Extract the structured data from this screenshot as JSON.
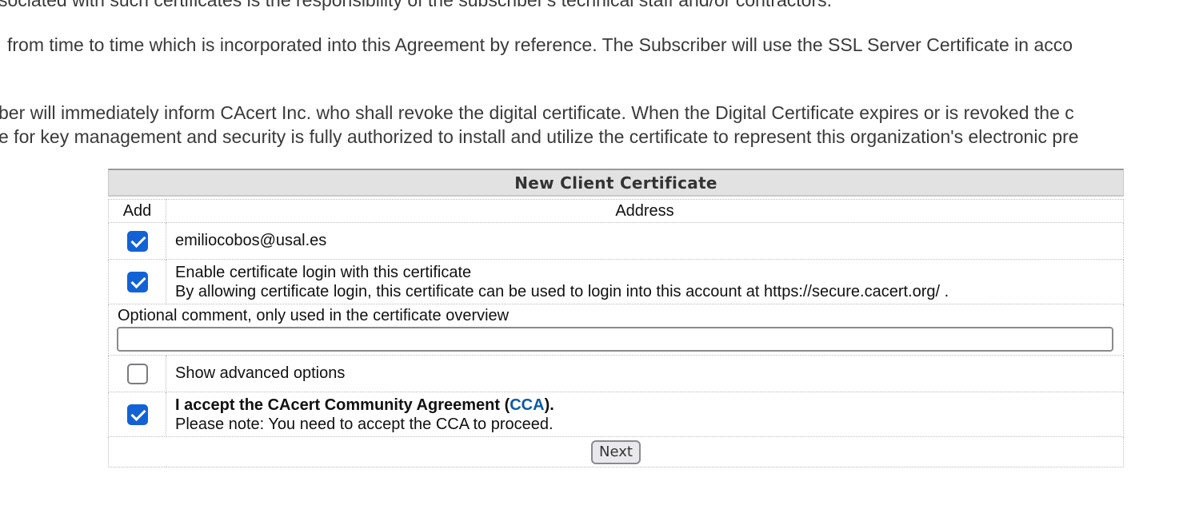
{
  "paragraphs": {
    "p1": "sociated with such certificates is the responsibility of the subscriber's technical staff and/or contractors.",
    "p2": "from time to time which is incorporated into this Agreement by reference. The Subscriber will use the SSL Server Certificate in acco",
    "p3": "ber will immediately inform CAcert Inc. who shall revoke the digital certificate. When the Digital Certificate expires or is revoked the c",
    "p4": "e for key management and security is fully authorized to install and utilize the certificate to represent this organization's electronic pre"
  },
  "form": {
    "title": "New Client Certificate",
    "col_add": "Add",
    "col_address": "Address",
    "email": "emiliocobos@usal.es",
    "email_checked": true,
    "login_label": "Enable certificate login with this certificate",
    "login_note": "By allowing certificate login, this certificate can be used to login into this account at https://secure.cacert.org/ .",
    "login_checked": true,
    "comment_label": "Optional comment, only used in the certificate overview",
    "comment_value": "",
    "advanced_label": "Show advanced options",
    "advanced_checked": false,
    "cca_prefix": "I accept the CAcert Community Agreement (",
    "cca_link": "CCA",
    "cca_suffix": ").",
    "cca_note": "Please note: You need to accept the CCA to proceed.",
    "cca_checked": true,
    "next_label": "Next"
  }
}
